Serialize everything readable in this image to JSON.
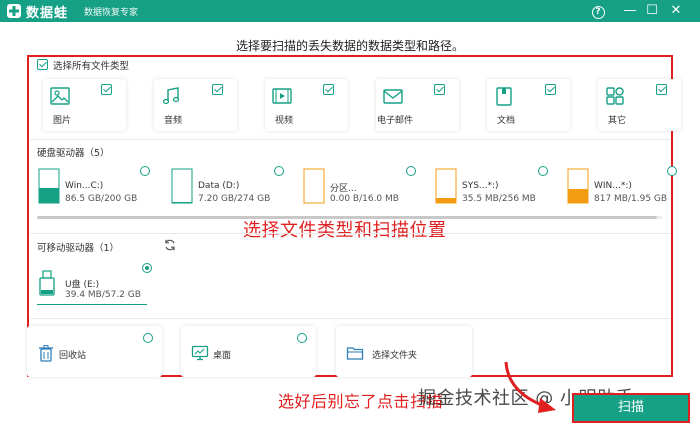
{
  "app": {
    "brand": "数据蛙",
    "subtitle": "数据恢复专家",
    "help_icon": "?",
    "minimize_icon": "—",
    "maximize_icon": "☐",
    "close_icon": "✕"
  },
  "instruction": "选择要扫描的丢失数据的数据类型和路径。",
  "file_types": {
    "select_all_label": "选择所有文件类型",
    "items": [
      {
        "label": "图片",
        "icon": "image-icon",
        "checked": true
      },
      {
        "label": "音频",
        "icon": "audio-icon",
        "checked": true
      },
      {
        "label": "视频",
        "icon": "video-icon",
        "checked": true
      },
      {
        "label": "电子邮件",
        "icon": "email-icon",
        "checked": true
      },
      {
        "label": "文档",
        "icon": "document-icon",
        "checked": true
      },
      {
        "label": "其它",
        "icon": "other-icon",
        "checked": true
      }
    ]
  },
  "hard_drives": {
    "title": "硬盘驱动器（5）",
    "items": [
      {
        "name": "Win...C:)",
        "size": "86.5 GB/200 GB",
        "used_fraction": 0.43,
        "color": "#16a085"
      },
      {
        "name": "Data (D:)",
        "size": "7.20 GB/274 GB",
        "used_fraction": 0.03,
        "color": "#16a085"
      },
      {
        "name": "分区...",
        "size": "0.00 B/16.0 MB",
        "used_fraction": 0.0,
        "color": "#f39c12"
      },
      {
        "name": "SYS...*:)",
        "size": "35.5 MB/256 MB",
        "used_fraction": 0.14,
        "color": "#f39c12"
      },
      {
        "name": "WIN...*:)",
        "size": "817 MB/1.95 GB",
        "used_fraction": 0.41,
        "color": "#f39c12"
      }
    ]
  },
  "removable_drives": {
    "title": "可移动驱动器（1）",
    "items": [
      {
        "name": "U盘 (E:)",
        "size": "39.4 MB/57.2 GB",
        "selected": true
      }
    ]
  },
  "locations": [
    {
      "label": "回收站",
      "icon": "recycle-bin-icon"
    },
    {
      "label": "桌面",
      "icon": "desktop-icon"
    },
    {
      "label": "选择文件夹",
      "icon": "folder-icon"
    }
  ],
  "annotations": {
    "main": "选择文件类型和扫描位置",
    "bottom": "选好后别忘了点击扫描",
    "watermark": "掘金技术社区 @ 小明助手"
  },
  "scan_button_label": "扫描",
  "colors": {
    "accent": "#16a085",
    "annotation": "#e02020",
    "warning": "#f39c12"
  }
}
